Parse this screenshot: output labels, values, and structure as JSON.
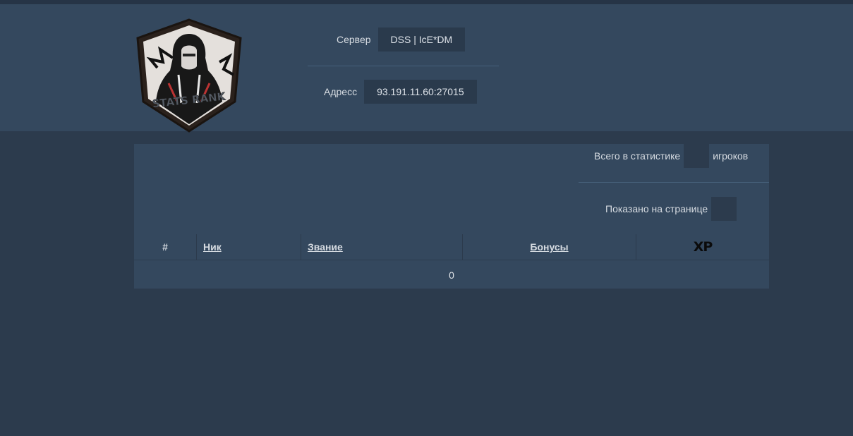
{
  "header": {
    "logo_text": "STATS RANK",
    "server_label": "Сервер",
    "server_value": "DSS | IcE*DM",
    "address_label": "Адресс",
    "address_value": "93.191.11.60:27015"
  },
  "stats": {
    "total_prefix": "Всего в статистике",
    "total_value": "",
    "total_suffix": "игроков",
    "shown_label": "Показано на странице",
    "shown_value": ""
  },
  "table": {
    "columns": [
      "#",
      "Ник",
      "Звание",
      "Бонусы",
      "XP"
    ],
    "rows_text": "0"
  },
  "colors": {
    "page_bg": "#2c3b4d",
    "panel_bg": "#34485e",
    "box_bg": "#2a3a4c"
  }
}
